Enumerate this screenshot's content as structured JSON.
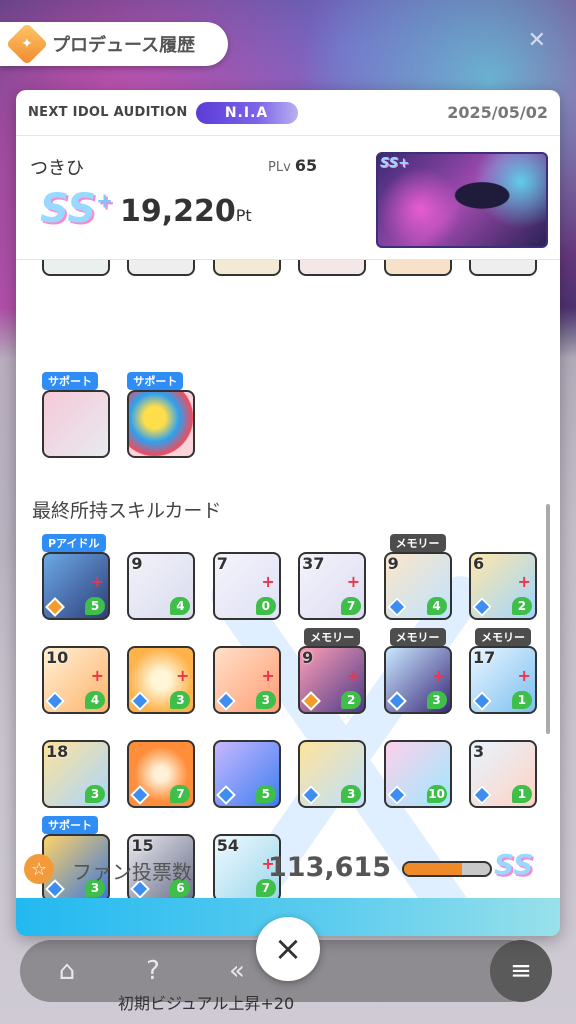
{
  "header": {
    "title": "プロデュース履歴",
    "close_glyph": "×"
  },
  "card": {
    "audition": "NEXT IDOL AUDITION",
    "tag": "N.I.A",
    "date": "2025/05/02",
    "name": "つきひ",
    "plv_label": "PLv",
    "plv_value": "65",
    "rank": "SS",
    "rank_plus": "+",
    "score": "19,220",
    "score_unit": "Pt",
    "thumb_badge": "SS+"
  },
  "support_row": {
    "items": [
      {
        "tag": "サポート"
      },
      {
        "tag": "サポート"
      }
    ]
  },
  "skill_section": {
    "title": "最終所持スキルカード",
    "rows": [
      [
        {
          "tag": "Pアイドル",
          "num": "",
          "cost": "5",
          "plus": "+"
        },
        {
          "tag": "",
          "num": "9",
          "cost": "4",
          "plus": ""
        },
        {
          "tag": "",
          "num": "7",
          "cost": "0",
          "plus": "+"
        },
        {
          "tag": "",
          "num": "37",
          "cost": "7",
          "plus": "+"
        },
        {
          "tag": "メモリー",
          "num": "9",
          "cost": "4",
          "plus": ""
        },
        {
          "tag": "",
          "num": "6",
          "cost": "2",
          "plus": "+"
        }
      ],
      [
        {
          "tag": "",
          "num": "10",
          "cost": "4",
          "plus": "+"
        },
        {
          "tag": "",
          "num": "",
          "cost": "3",
          "plus": "+"
        },
        {
          "tag": "",
          "num": "",
          "cost": "3",
          "plus": "+"
        },
        {
          "tag": "メモリー",
          "num": "9",
          "cost": "2",
          "plus": "+"
        },
        {
          "tag": "メモリー",
          "num": "",
          "cost": "3",
          "plus": "+"
        },
        {
          "tag": "メモリー",
          "num": "17",
          "cost": "1",
          "plus": "+"
        }
      ],
      [
        {
          "tag": "",
          "num": "18",
          "cost": "3",
          "plus": ""
        },
        {
          "tag": "",
          "num": "",
          "cost": "7",
          "plus": ""
        },
        {
          "tag": "",
          "num": "",
          "cost": "5",
          "plus": ""
        },
        {
          "tag": "",
          "num": "",
          "cost": "3",
          "plus": ""
        },
        {
          "tag": "",
          "num": "",
          "cost": "10",
          "plus": ""
        },
        {
          "tag": "",
          "num": "3",
          "cost": "1",
          "plus": ""
        }
      ],
      [
        {
          "tag": "サポート",
          "num": "",
          "cost": "3",
          "plus": ""
        },
        {
          "tag": "",
          "num": "15",
          "cost": "6",
          "plus": ""
        },
        {
          "tag": "",
          "num": "54",
          "cost": "7",
          "plus": "+"
        }
      ]
    ]
  },
  "fan_vote": {
    "label": "ファン投票数",
    "value": "113,615",
    "bar_fraction": 0.68,
    "rank": "SS"
  },
  "bottom": {
    "caption": "初期ビジュアル上昇+20"
  },
  "colors": {
    "accent_blue": "#2f8df5",
    "cost_green": "#3fbf4a",
    "fan_orange": "#f08a28"
  }
}
